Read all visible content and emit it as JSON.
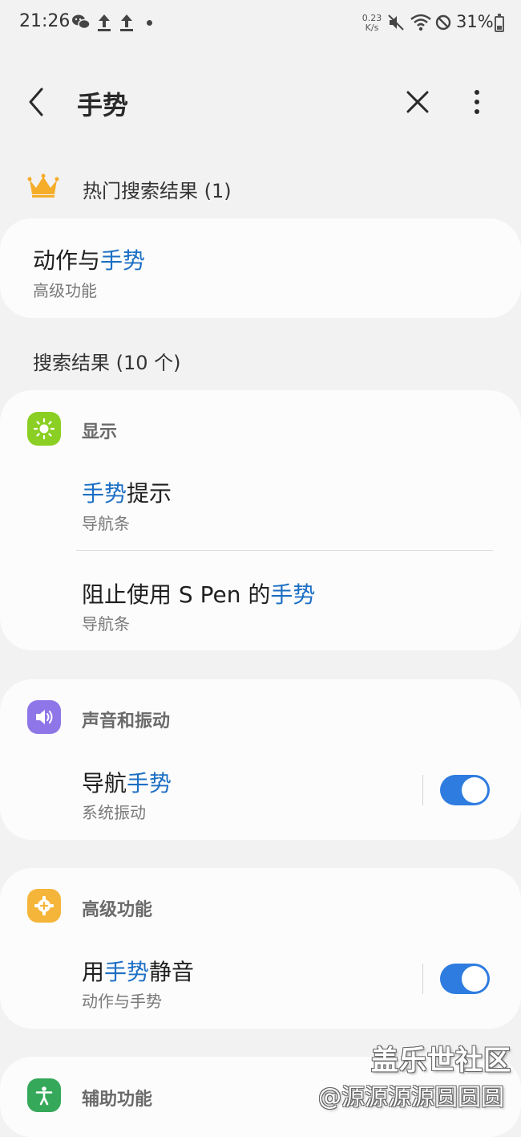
{
  "status_bar": {
    "time": "21:26",
    "net_speed_value": "0.23",
    "net_speed_unit": "K/s",
    "battery": "31%",
    "icons": [
      "wechat-icon",
      "upload-icon",
      "upload-icon",
      "dot-icon",
      "mute-icon",
      "wifi-icon",
      "dnd-icon",
      "battery-icon"
    ]
  },
  "header": {
    "title": "手势",
    "icons": [
      "back-icon",
      "close-icon",
      "more-vert-icon"
    ]
  },
  "hot": {
    "title": "热门搜索结果 (1)",
    "item": {
      "title_pre": "动作与",
      "title_hl": "手势",
      "sub": "高级功能"
    }
  },
  "results": {
    "title": "搜索结果 (10 个)",
    "groups": [
      {
        "category": "显示",
        "icon": "brightness-icon",
        "icon_color": "#8bcf24",
        "items": [
          {
            "title_hl": "手势",
            "title_post": "提示",
            "sub": "导航条"
          },
          {
            "title_pre": "阻止使用 S Pen 的",
            "title_hl": "手势",
            "sub": "导航条"
          }
        ]
      },
      {
        "category": "声音和振动",
        "icon": "volume-icon",
        "icon_color": "#8f76e8",
        "items": [
          {
            "title_pre": "导航",
            "title_hl": "手势",
            "sub": "系统振动",
            "toggle": true
          }
        ]
      },
      {
        "category": "高级功能",
        "icon": "gear-plus-icon",
        "icon_color": "#f5b53a",
        "items": [
          {
            "title_pre": "用",
            "title_hl": "手势",
            "title_post": "静音",
            "sub": "动作与手势",
            "toggle": true
          }
        ]
      },
      {
        "category": "辅助功能",
        "icon": "accessibility-icon",
        "icon_color": "#35a85a"
      }
    ]
  },
  "colors": {
    "highlight": "#1c6fc4",
    "toggle_on": "#2e7ce0",
    "background": "#f2f2f2",
    "card": "#fcfcfc"
  },
  "watermark": {
    "line1": "盖乐世社区",
    "line2": "@源源源源圆圆圆"
  }
}
